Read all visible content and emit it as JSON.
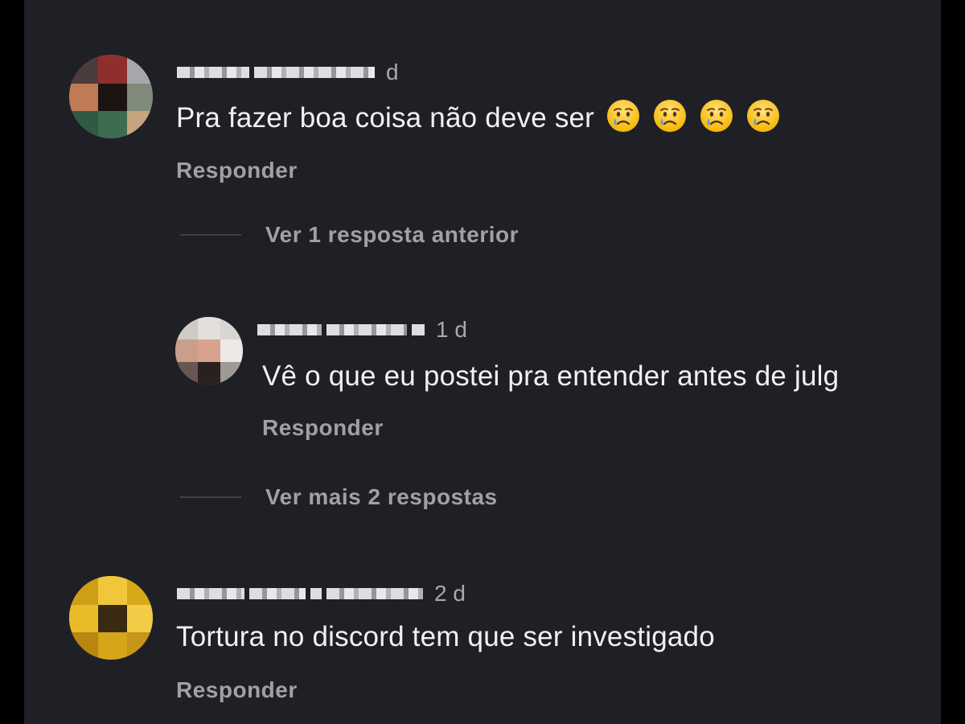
{
  "comments": [
    {
      "time": "d",
      "text": "Pra fazer boa coisa não deve ser",
      "emoji_count": 4,
      "emoji_icon": "crying-face-emoji",
      "reply_label": "Responder"
    },
    {
      "time": "1 d",
      "text": "Vê o que eu postei pra entender antes de julg",
      "reply_label": "Responder"
    },
    {
      "time": "2 d",
      "text": "Tortura no discord  tem que ser investigado",
      "reply_label": "Responder"
    }
  ],
  "threads": {
    "previous_replies_label": "Ver 1 resposta anterior",
    "more_replies_label": "Ver mais 2 respostas"
  },
  "colors": {
    "background": "#1f2026",
    "text": "#f1f1f3",
    "secondary_text": "#a0a1a7"
  }
}
